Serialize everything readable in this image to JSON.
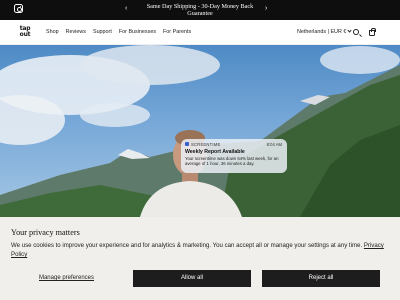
{
  "announcement": {
    "prev_arrow": "‹",
    "next_arrow": "›",
    "text": "Same Day Shipping - 30-Day Money Back Guarantee"
  },
  "header": {
    "logo_line1": "tap",
    "logo_line2": "out",
    "nav": [
      "Shop",
      "Reviews",
      "Support",
      "For Businesses",
      "For Parents"
    ],
    "locale": "Netherlands | EUR €"
  },
  "notification": {
    "app": "SCREENTIME",
    "time": "8:04 AM",
    "title": "Weekly Report Available",
    "body": "Your screentime was down 64% last week, for an average of 1 hour, 36 minutes a day."
  },
  "cookie": {
    "title": "Your privacy matters",
    "text": "We use cookies to improve your experience and for analytics & marketing. You can accept all or manage your settings at any time.",
    "policy_link": "Privacy Policy",
    "manage_label": "Manage preferences",
    "allow_label": "Allow all",
    "reject_label": "Reject all"
  },
  "colors": {
    "announcement_bg": "#0e0e0e",
    "cookie_bg": "#f1efeb",
    "button_bg": "#1d1d1d"
  }
}
